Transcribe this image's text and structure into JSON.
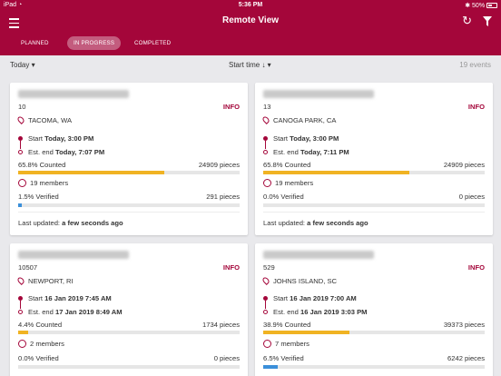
{
  "status_bar": {
    "carrier": "iPad",
    "time": "5:36 PM",
    "battery": "50%"
  },
  "header": {
    "title": "Remote View"
  },
  "tabs": [
    {
      "label": "PLANNED",
      "active": false
    },
    {
      "label": "IN PROGRESS",
      "active": true
    },
    {
      "label": "COMPLETED",
      "active": false
    }
  ],
  "toolbar": {
    "date_filter": "Today ▾",
    "sort": "Start time ↓ ▾",
    "event_count": "19 events"
  },
  "colors": {
    "accent": "#a4063a",
    "counted": "#f0b323",
    "verified": "#3b8fd9"
  },
  "cards": [
    {
      "number": "10",
      "info": "INFO",
      "location": "TACOMA, WA",
      "start_label": "Start",
      "start": "Today, 3:00 PM",
      "end_label": "Est. end",
      "end": "Today, 7:07 PM",
      "counted": "65.8% Counted",
      "counted_pct": 65.8,
      "pieces": "24909 pieces",
      "members": "19 members",
      "verified": "1.5% Verified",
      "verified_pct": 1.5,
      "verified_pieces": "291 pieces",
      "updated_label": "Last updated:",
      "updated": "a few seconds ago"
    },
    {
      "number": "13",
      "info": "INFO",
      "location": "CANOGA PARK, CA",
      "start_label": "Start",
      "start": "Today, 3:00 PM",
      "end_label": "Est. end",
      "end": "Today, 7:11 PM",
      "counted": "65.8% Counted",
      "counted_pct": 65.8,
      "pieces": "24909 pieces",
      "members": "19 members",
      "verified": "0.0% Verified",
      "verified_pct": 0,
      "verified_pieces": "0 pieces",
      "updated_label": "Last updated:",
      "updated": "a few seconds ago"
    },
    {
      "number": "10507",
      "info": "INFO",
      "location": "NEWPORT, RI",
      "start_label": "Start",
      "start": "16 Jan 2019 7:45 AM",
      "end_label": "Est. end",
      "end": "17 Jan 2019 8:49 AM",
      "counted": "4.4% Counted",
      "counted_pct": 4.4,
      "pieces": "1734 pieces",
      "members": "2 members",
      "verified": "0.0% Verified",
      "verified_pct": 0,
      "verified_pieces": "0 pieces"
    },
    {
      "number": "529",
      "info": "INFO",
      "location": "JOHNS ISLAND, SC",
      "start_label": "Start",
      "start": "16 Jan 2019 7:00 AM",
      "end_label": "Est. end",
      "end": "16 Jan 2019 3:03 PM",
      "counted": "38.9% Counted",
      "counted_pct": 38.9,
      "pieces": "39373 pieces",
      "members": "7 members",
      "verified": "6.5% Verified",
      "verified_pct": 6.5,
      "verified_pieces": "6242 pieces"
    }
  ]
}
